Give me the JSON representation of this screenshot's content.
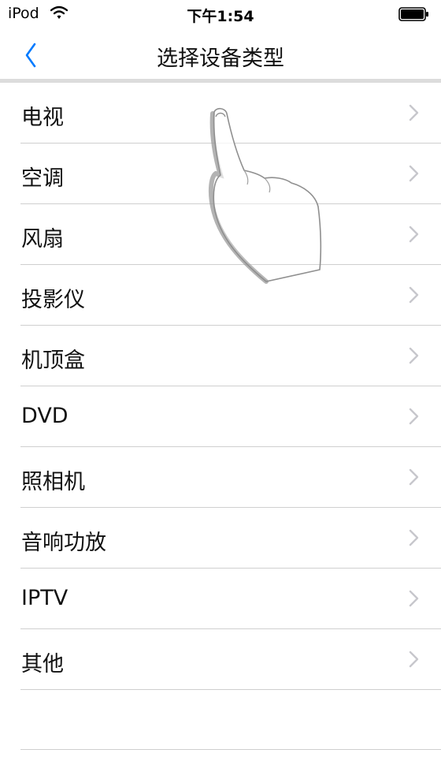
{
  "status_bar": {
    "carrier": "iPod",
    "time": "下午1:54"
  },
  "nav": {
    "title": "选择设备类型",
    "back_icon": "chevron-left-icon"
  },
  "devices": [
    {
      "label": "电视"
    },
    {
      "label": "空调"
    },
    {
      "label": "风扇"
    },
    {
      "label": "投影仪"
    },
    {
      "label": "机顶盒"
    },
    {
      "label": "DVD"
    },
    {
      "label": "照相机"
    },
    {
      "label": "音响功放"
    },
    {
      "label": "IPTV"
    },
    {
      "label": "其他"
    }
  ],
  "colors": {
    "accent": "#007aff",
    "divider": "#cfcfcf",
    "chevron": "#c7c7cc"
  }
}
